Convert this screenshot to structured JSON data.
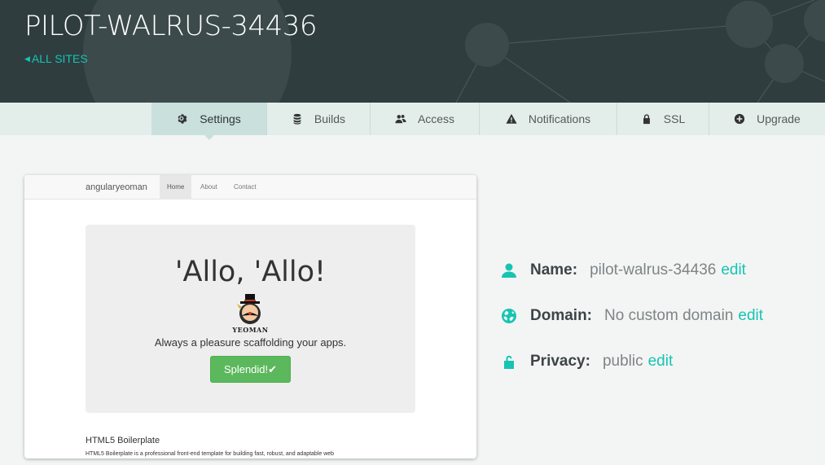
{
  "header": {
    "site_name": "PILOT-WALRUS-34436",
    "all_sites_label": "ALL SITES"
  },
  "tabs": [
    {
      "label": "Settings",
      "icon": "gear-icon",
      "active": true
    },
    {
      "label": "Builds",
      "icon": "database-icon"
    },
    {
      "label": "Access",
      "icon": "users-icon"
    },
    {
      "label": "Notifications",
      "icon": "warning-icon"
    },
    {
      "label": "SSL",
      "icon": "lock-icon"
    },
    {
      "label": "Upgrade",
      "icon": "plus-circle-icon"
    }
  ],
  "preview": {
    "brand": "angularyeoman",
    "nav": [
      "Home",
      "About",
      "Contact"
    ],
    "headline": "'Allo, 'Allo!",
    "logo_text": "YEOMAN",
    "lead": "Always a pleasure scaffolding your apps.",
    "button_label": "Splendid!✔",
    "section_title": "HTML5 Boilerplate",
    "section_text": "HTML5 Boilerplate is a professional front-end template for building fast, robust, and adaptable web"
  },
  "info": {
    "name": {
      "label": "Name:",
      "value": "pilot-walrus-34436",
      "edit": "edit",
      "icon": "user-icon"
    },
    "domain": {
      "label": "Domain:",
      "value": "No custom domain",
      "edit": "edit",
      "icon": "globe-icon"
    },
    "privacy": {
      "label": "Privacy:",
      "value": "public",
      "edit": "edit",
      "icon": "unlock-icon"
    }
  },
  "colors": {
    "accent": "#16c4b4",
    "header_bg": "#2f3d3f",
    "tab_bar": "#e3eeeb",
    "tab_active": "#c9e0dd",
    "success_button": "#5cb85c"
  }
}
